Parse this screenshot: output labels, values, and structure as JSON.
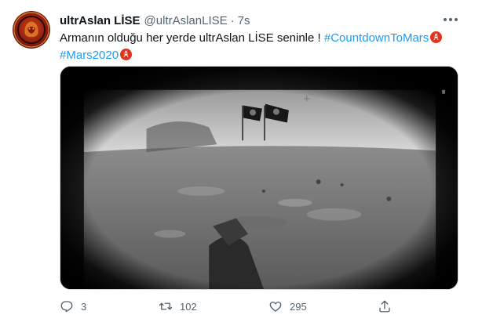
{
  "tweet": {
    "display_name": "ultrAslan LİSE",
    "handle": "@ultrAslanLISE",
    "separator": "·",
    "timestamp": "7s",
    "text_line1": "Armanın olduğu her yerde ultrAslan LİSE seninle !",
    "hashtag1": "#CountdownToMars",
    "hashtag2": "#Mars2020",
    "media_icon": "rocket-emoji"
  },
  "actions": {
    "reply_count": "3",
    "retweet_count": "102",
    "like_count": "295"
  },
  "colors": {
    "hashtag": "#1d9bf0",
    "muted": "#536471",
    "text": "#0f1419"
  }
}
